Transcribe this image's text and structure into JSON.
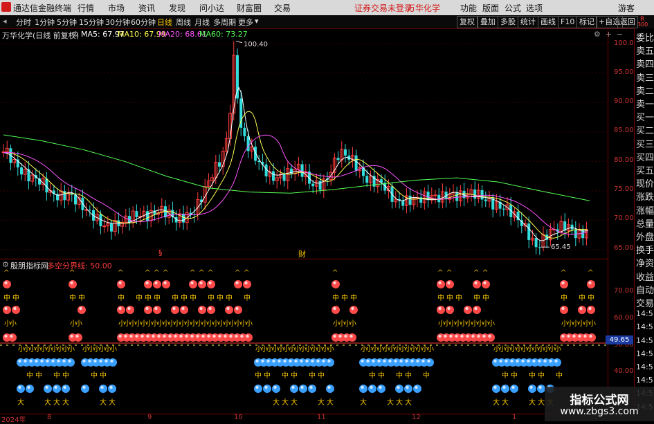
{
  "menu": {
    "app_title": "通达信金融终端",
    "items": [
      "行情",
      "市场",
      "资讯",
      "发现",
      "问小达",
      "财富圈",
      "交易"
    ],
    "login_status": "证券交易未登录",
    "stock_name": "万华化学",
    "right_items": [
      "功能",
      "版面",
      "公式",
      "选项"
    ],
    "user": "游客"
  },
  "toolbar": {
    "periods": [
      "分时",
      "1分钟",
      "5分钟",
      "15分钟",
      "30分钟",
      "60分钟",
      "日线",
      "周线",
      "月线",
      "多周期",
      "更多"
    ],
    "active_period": "日线",
    "right_buttons": [
      "复权",
      "叠加",
      "多股",
      "统计",
      "画线",
      "F10",
      "标记",
      "+自选",
      "返回"
    ]
  },
  "main_chart": {
    "title": "万华化学(日线 前复权)",
    "ma_legend": [
      {
        "label": "MA5: 67.97",
        "color": "#ffffff"
      },
      {
        "label": "MA10: 67.99",
        "color": "#ffff55"
      },
      {
        "label": "MA20: 68.61",
        "color": "#ff55ff"
      },
      {
        "label": "MA60: 73.27",
        "color": "#55ff55"
      }
    ],
    "high_annotation": "100.40",
    "low_annotation": "65.45",
    "event_markers": [
      "§",
      "财"
    ],
    "y_ticks": [
      "100.0",
      "95.00",
      "90.00",
      "85.00",
      "80.00",
      "75.00",
      "70.00",
      "65.00"
    ]
  },
  "indicator_panel": {
    "title": "殷朋指标网",
    "line_label": "多空分界线: 50.00",
    "y_ticks": [
      "70.00",
      "60.00",
      "50.00",
      "40.00"
    ],
    "current_value": "49.65"
  },
  "right_panel": {
    "labels": [
      "委比",
      "卖五",
      "卖四",
      "卖三",
      "卖二",
      "卖一",
      "买一",
      "买二",
      "买三",
      "买四",
      "买五",
      "现价",
      "涨跌",
      "涨幅",
      "总量",
      "外盘",
      "换手",
      "净资",
      "收益",
      "自动",
      "交易",
      "14:5",
      "14:5",
      "14:5",
      "14:5",
      "14:5",
      "14:5",
      "14:5",
      "14:5"
    ],
    "top_code_1": "R",
    "top_code_2": "300"
  },
  "x_axis": {
    "labels": [
      "2024年",
      "8",
      "9",
      "10",
      "11",
      "12",
      "1"
    ]
  },
  "watermark": {
    "line1": "指标公式网",
    "line2": "www.zbgs3.com"
  },
  "colors": {
    "up": "#ff3c3c",
    "down": "#33dddd",
    "ma5": "#ffffff",
    "ma10": "#ffff55",
    "ma20": "#ff55ff",
    "ma60": "#55ff55",
    "axis_red": "#cc3333"
  }
}
